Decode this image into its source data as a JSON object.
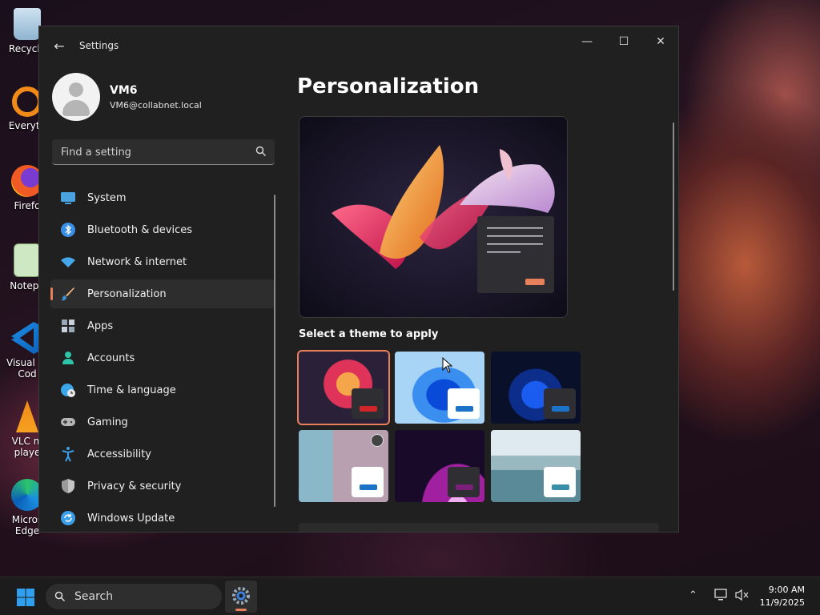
{
  "desktop": {
    "icons": [
      {
        "label": "Recycle"
      },
      {
        "label": "Everyth"
      },
      {
        "label": "Firefo"
      },
      {
        "label": "Notepa"
      },
      {
        "label": "Visual St"
      },
      {
        "label": "Cod"
      },
      {
        "label": "VLC m"
      },
      {
        "label": "playe"
      },
      {
        "label": "Micros"
      },
      {
        "label": "Edge"
      }
    ]
  },
  "window": {
    "title": "Settings",
    "minimize": "—",
    "maximize": "☐",
    "close": "✕"
  },
  "profile": {
    "name": "VM6",
    "email": "VM6@collabnet.local"
  },
  "search": {
    "placeholder": "Find a setting"
  },
  "nav": {
    "items": [
      {
        "label": "System",
        "icon": "monitor-icon",
        "color": "#4aa3df"
      },
      {
        "label": "Bluetooth & devices",
        "icon": "bluetooth-icon",
        "color": "#3b8ee6"
      },
      {
        "label": "Network & internet",
        "icon": "wifi-icon",
        "color": "#45a6e8"
      },
      {
        "label": "Personalization",
        "icon": "brush-icon",
        "color": "#f2b37a",
        "selected": true
      },
      {
        "label": "Apps",
        "icon": "apps-icon",
        "color": "#9aa7b8"
      },
      {
        "label": "Accounts",
        "icon": "person-icon",
        "color": "#2ec4a8"
      },
      {
        "label": "Time & language",
        "icon": "globe-clock-icon",
        "color": "#3ba7e8"
      },
      {
        "label": "Gaming",
        "icon": "gamepad-icon",
        "color": "#b8b8b8"
      },
      {
        "label": "Accessibility",
        "icon": "accessibility-icon",
        "color": "#3b9ee8"
      },
      {
        "label": "Privacy & security",
        "icon": "shield-icon",
        "color": "#9a9a9a"
      },
      {
        "label": "Windows Update",
        "icon": "update-icon",
        "color": "#3b9ee8"
      }
    ]
  },
  "content": {
    "title": "Personalization",
    "theme_heading": "Select a theme to apply",
    "themes": [
      {
        "name": "windows-glow",
        "bar": "#d0262b",
        "selected": true
      },
      {
        "name": "windows-light",
        "bar": "#1a73c8"
      },
      {
        "name": "windows-dark",
        "bar": "#1a73c8"
      },
      {
        "name": "spotlight",
        "bar": "#1a73c8"
      },
      {
        "name": "glow",
        "bar": "#7a1f7a"
      },
      {
        "name": "captured-motion",
        "bar": "#3a8fa8"
      }
    ]
  },
  "taskbar": {
    "search_label": "Search",
    "time": "9:00 AM",
    "date": "11/9/2025"
  }
}
